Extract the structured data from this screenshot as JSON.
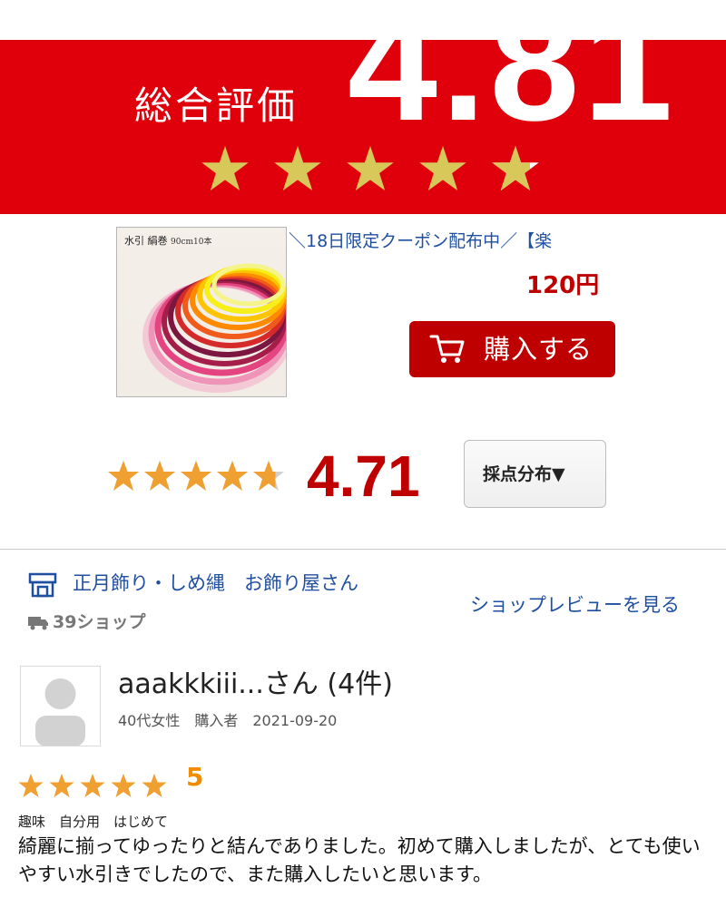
{
  "banner": {
    "label": "総合評価",
    "score": "4.81",
    "star_rating": 4.81,
    "star_color": "#d8c85a",
    "background": "#e0000c"
  },
  "product": {
    "image_caption_main": "水引 絹巻",
    "image_caption_sub": "90cm10本",
    "title": "＼18日限定クーポン配布中／【楽",
    "price": "120円",
    "buy_button_label": "購入する",
    "buy_button_icon": "cart-icon"
  },
  "rating": {
    "average": "4.71",
    "star_rating": 4.71,
    "distribution_button_label": "採点分布▼"
  },
  "shop": {
    "icon": "shop-icon",
    "name": "正月飾り・しめ縄　お飾り屋さん",
    "badge_icon": "truck-icon",
    "badge": "39ショップ",
    "review_link": "ショップレビューを見る"
  },
  "review": {
    "reviewer_name": "aaakkkiii...さん (4件)",
    "reviewer_meta": "40代女性　購入者　2021-09-20",
    "star_rating": 5,
    "score": "5",
    "tags": "趣味　自分用　はじめて",
    "body": "綺麗に揃ってゆったりと結んでありました。初めて購入しましたが、とても使いやすい水引きでしたので、また購入したいと思います。"
  }
}
